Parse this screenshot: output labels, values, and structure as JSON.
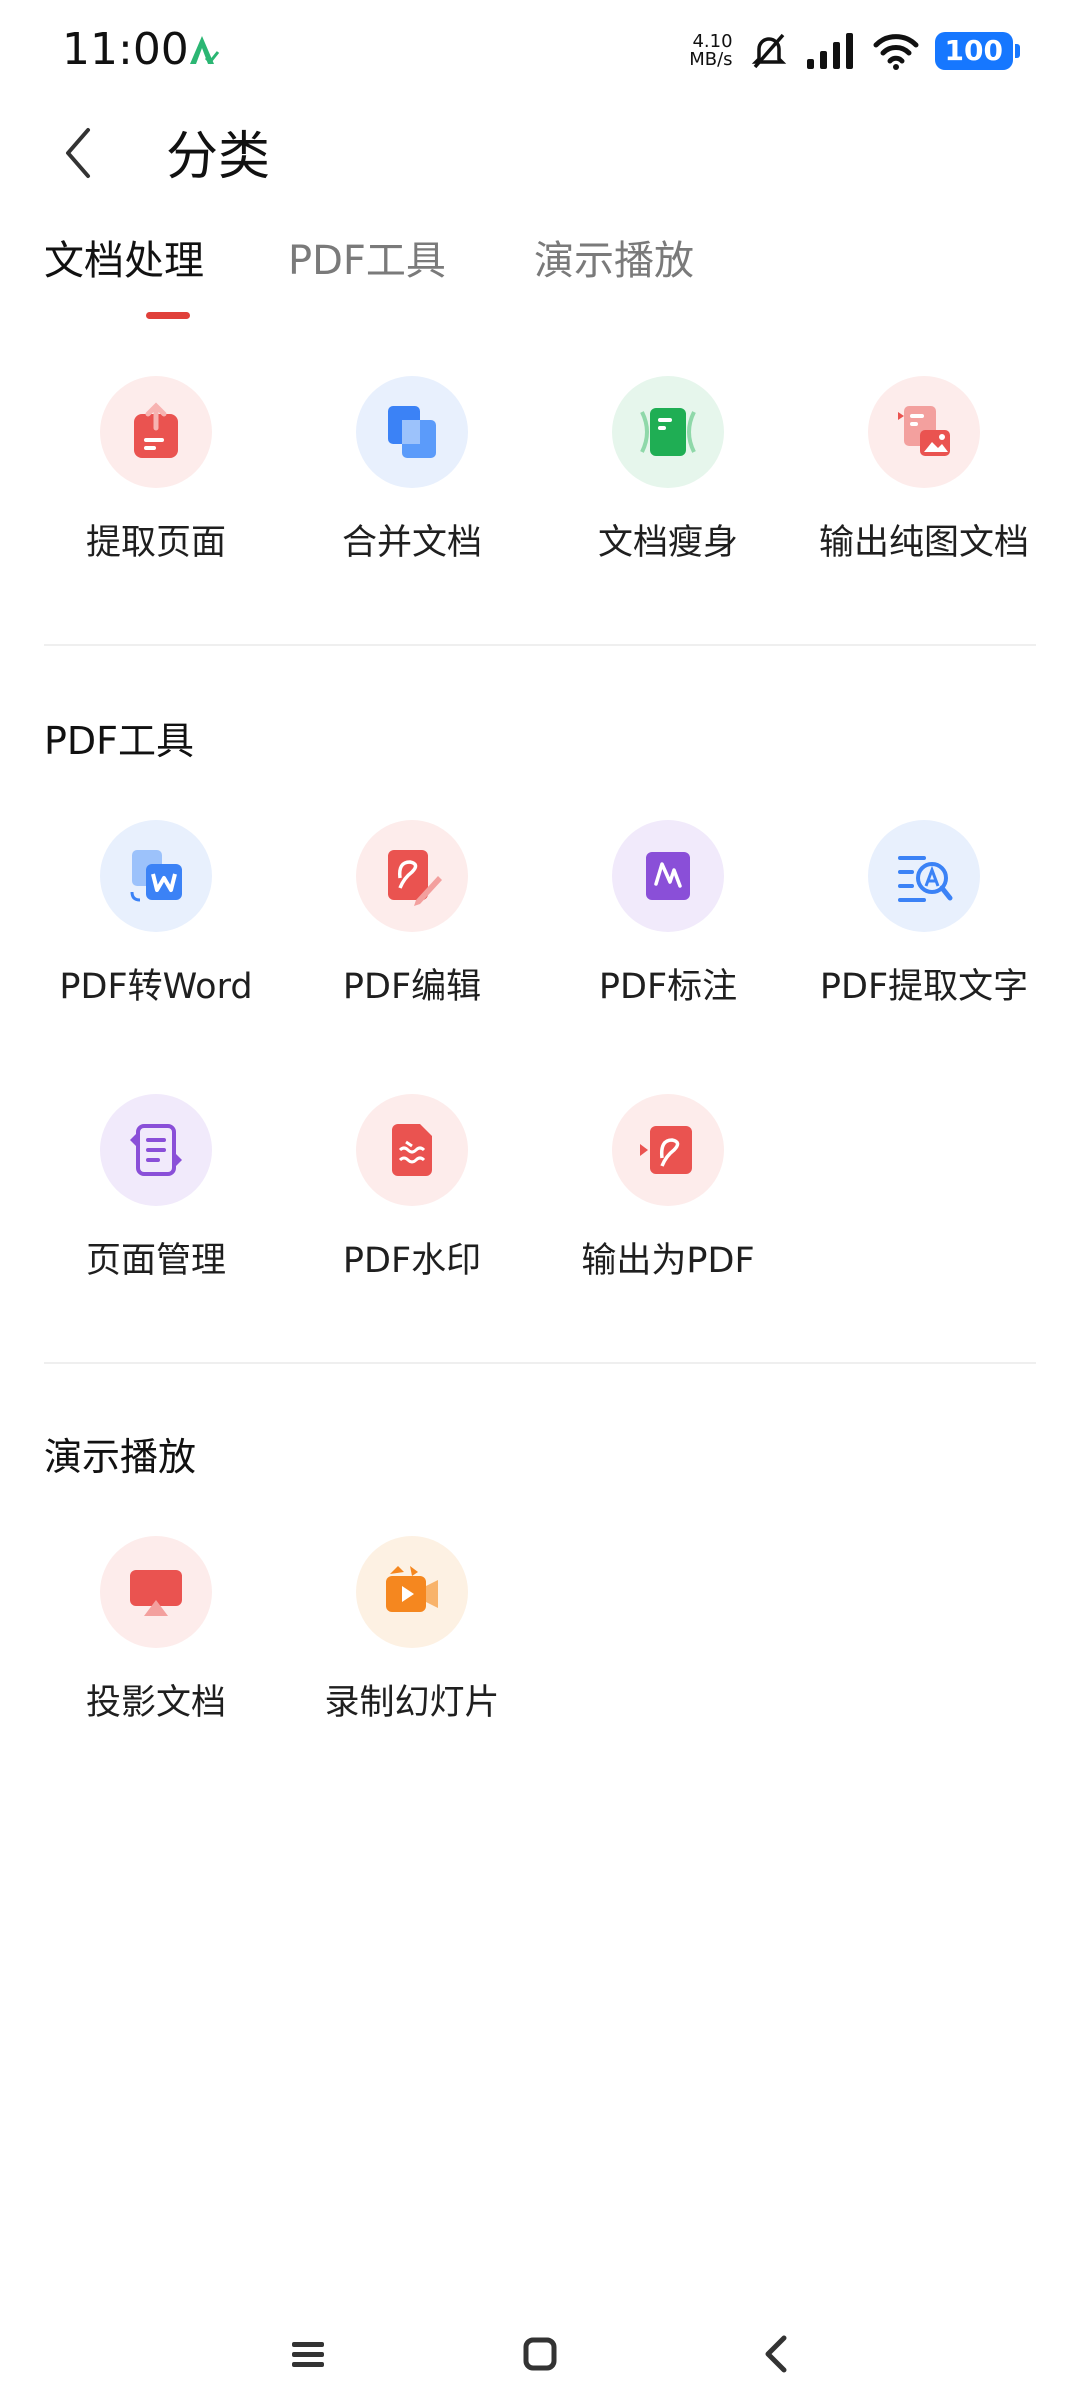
{
  "status_bar": {
    "time": "11:00",
    "net_speed_value": "4.10",
    "net_speed_unit": "MB/s",
    "battery": "100"
  },
  "header": {
    "title": "分类"
  },
  "tabs": [
    {
      "label": "文档处理",
      "active": true
    },
    {
      "label": "PDF工具",
      "active": false
    },
    {
      "label": "演示播放",
      "active": false
    }
  ],
  "sections": {
    "doc_processing": {
      "items": [
        {
          "label": "提取页面",
          "icon": "extract-page-icon"
        },
        {
          "label": "合并文档",
          "icon": "merge-doc-icon"
        },
        {
          "label": "文档瘦身",
          "icon": "slim-doc-icon"
        },
        {
          "label": "输出纯图文档",
          "icon": "image-doc-icon"
        }
      ]
    },
    "pdf_tools": {
      "title": "PDF工具",
      "items": [
        {
          "label": "PDF转Word",
          "icon": "pdf-to-word-icon"
        },
        {
          "label": "PDF编辑",
          "icon": "pdf-edit-icon"
        },
        {
          "label": "PDF标注",
          "icon": "pdf-annotate-icon"
        },
        {
          "label": "PDF提取文字",
          "icon": "pdf-ocr-icon"
        },
        {
          "label": "页面管理",
          "icon": "page-manage-icon"
        },
        {
          "label": "PDF水印",
          "icon": "pdf-watermark-icon"
        },
        {
          "label": "输出为PDF",
          "icon": "export-pdf-icon"
        }
      ]
    },
    "presentation": {
      "title": "演示播放",
      "items": [
        {
          "label": "投影文档",
          "icon": "project-doc-icon"
        },
        {
          "label": "录制幻灯片",
          "icon": "record-slides-icon"
        }
      ]
    }
  },
  "colors": {
    "accent": "#e0403a",
    "red": "#ea5350",
    "blue": "#3b82f6",
    "green": "#1fae54",
    "purple": "#8a4fd8",
    "orange": "#f5871f"
  }
}
